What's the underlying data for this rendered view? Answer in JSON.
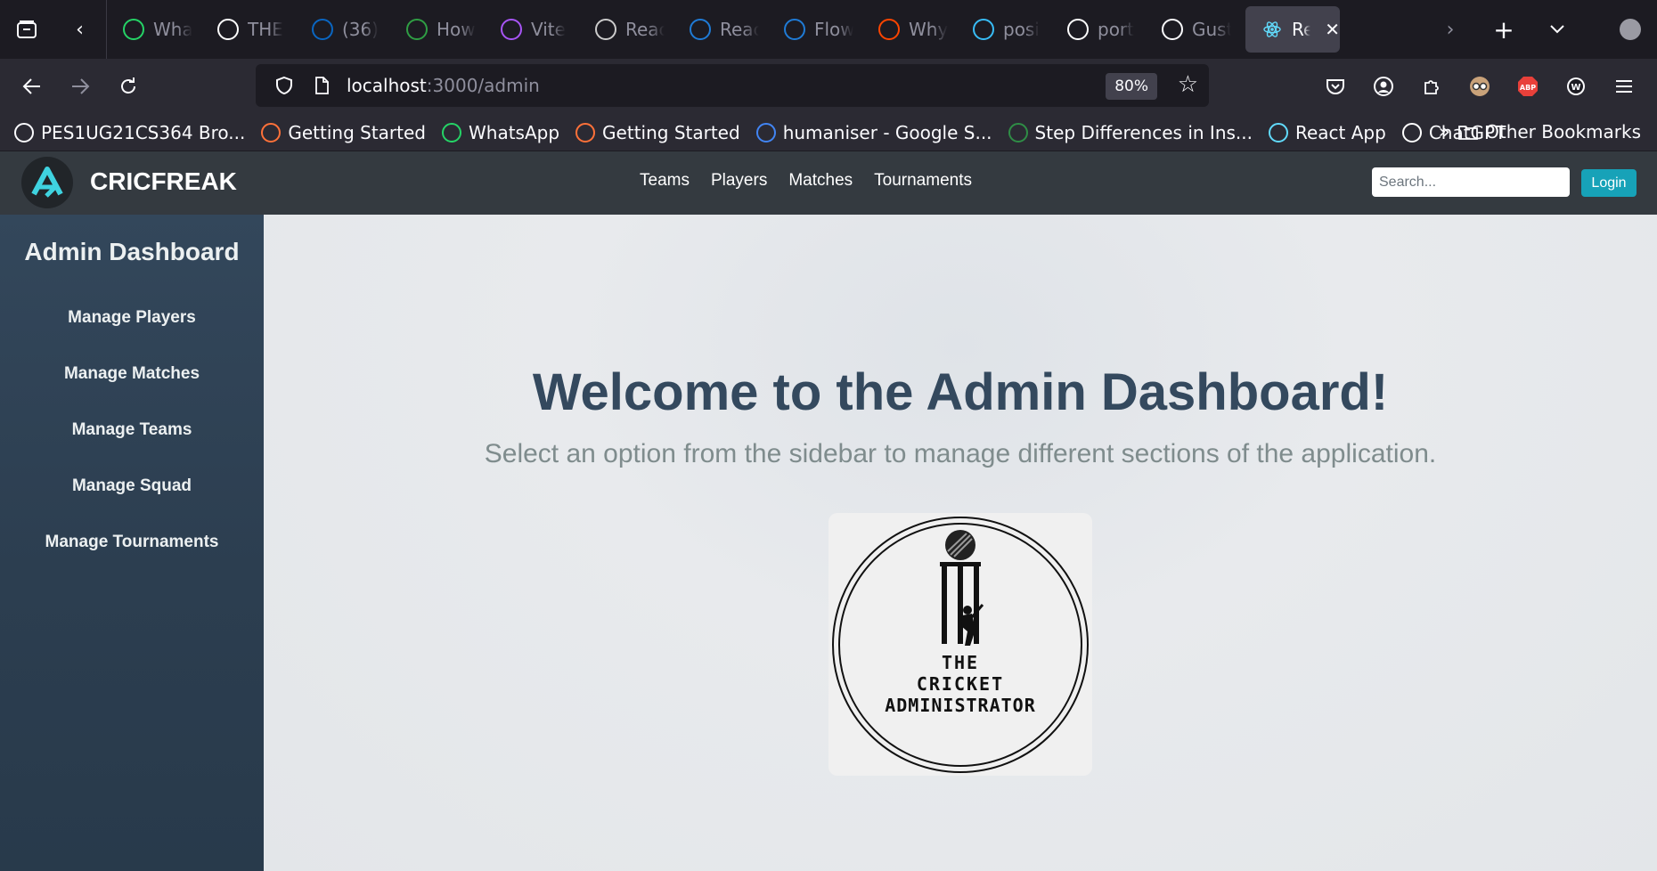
{
  "browser": {
    "tabs": [
      {
        "label": "Wha",
        "icon": "whatsapp-icon",
        "color": "#25d366"
      },
      {
        "label": "THE",
        "icon": "notion-icon",
        "color": "#ffffff"
      },
      {
        "label": "(36)",
        "icon": "linkedin-icon",
        "color": "#0a66c2"
      },
      {
        "label": "How",
        "icon": "w-icon",
        "color": "#2f9e44"
      },
      {
        "label": "Vite",
        "icon": "vite-icon",
        "color": "#a855f7"
      },
      {
        "label": "Reac",
        "icon": "openai-icon",
        "color": "#cccccc"
      },
      {
        "label": "Reac",
        "icon": "play-icon",
        "color": "#1f7bd6"
      },
      {
        "label": "Flow",
        "icon": "play-icon",
        "color": "#1f7bd6"
      },
      {
        "label": "Why",
        "icon": "reddit-icon",
        "color": "#ff4500"
      },
      {
        "label": "posi",
        "icon": "tailwind-icon",
        "color": "#38bdf8"
      },
      {
        "label": "port",
        "icon": "github-icon",
        "color": "#ffffff"
      },
      {
        "label": "Gust",
        "icon": "google-icon",
        "color": "#fbfbfe"
      }
    ],
    "active_tab": {
      "label": "Re",
      "icon": "react-icon",
      "color": "#61dafb"
    },
    "url_host": "localhost",
    "url_path": ":3000/admin",
    "zoom": "80%",
    "bookmarks": [
      {
        "label": "PES1UG21CS364 Bro...",
        "icon": "globe-icon",
        "color": "#fbfbfe"
      },
      {
        "label": "Getting Started",
        "icon": "firefox-icon",
        "color": "#ff7139"
      },
      {
        "label": "WhatsApp",
        "icon": "whatsapp-icon",
        "color": "#25d366"
      },
      {
        "label": "Getting Started",
        "icon": "firefox-icon",
        "color": "#ff7139"
      },
      {
        "label": "humaniser - Google S...",
        "icon": "google-icon",
        "color": "#4285f4"
      },
      {
        "label": "Step Differences in Ins...",
        "icon": "gfg-icon",
        "color": "#2f8d46"
      },
      {
        "label": "React App",
        "icon": "react-icon",
        "color": "#61dafb"
      },
      {
        "label": "ChatGPT",
        "icon": "openai-icon",
        "color": "#ffffff"
      }
    ],
    "other_bookmarks": "Other Bookmarks"
  },
  "app": {
    "brand": "CRICFREAK",
    "nav": [
      "Teams",
      "Players",
      "Matches",
      "Tournaments"
    ],
    "search_placeholder": "Search...",
    "login_label": "Login",
    "sidebar_title": "Admin Dashboard",
    "sidebar_items": [
      "Manage Players",
      "Manage Matches",
      "Manage Teams",
      "Manage Squad",
      "Manage Tournaments"
    ],
    "welcome_title": "Welcome to the Admin Dashboard!",
    "welcome_subtitle": "Select an option from the sidebar to manage different sections of the application.",
    "logo_text": [
      "THE",
      "CRICKET",
      "ADMINISTRATOR"
    ]
  },
  "colors": {
    "header_bg": "#343a40",
    "sidebar_bg": "#2c3e50",
    "login_button": "#17a2b8",
    "welcome_title": "#34495e",
    "subtitle": "#7f8c8d"
  }
}
